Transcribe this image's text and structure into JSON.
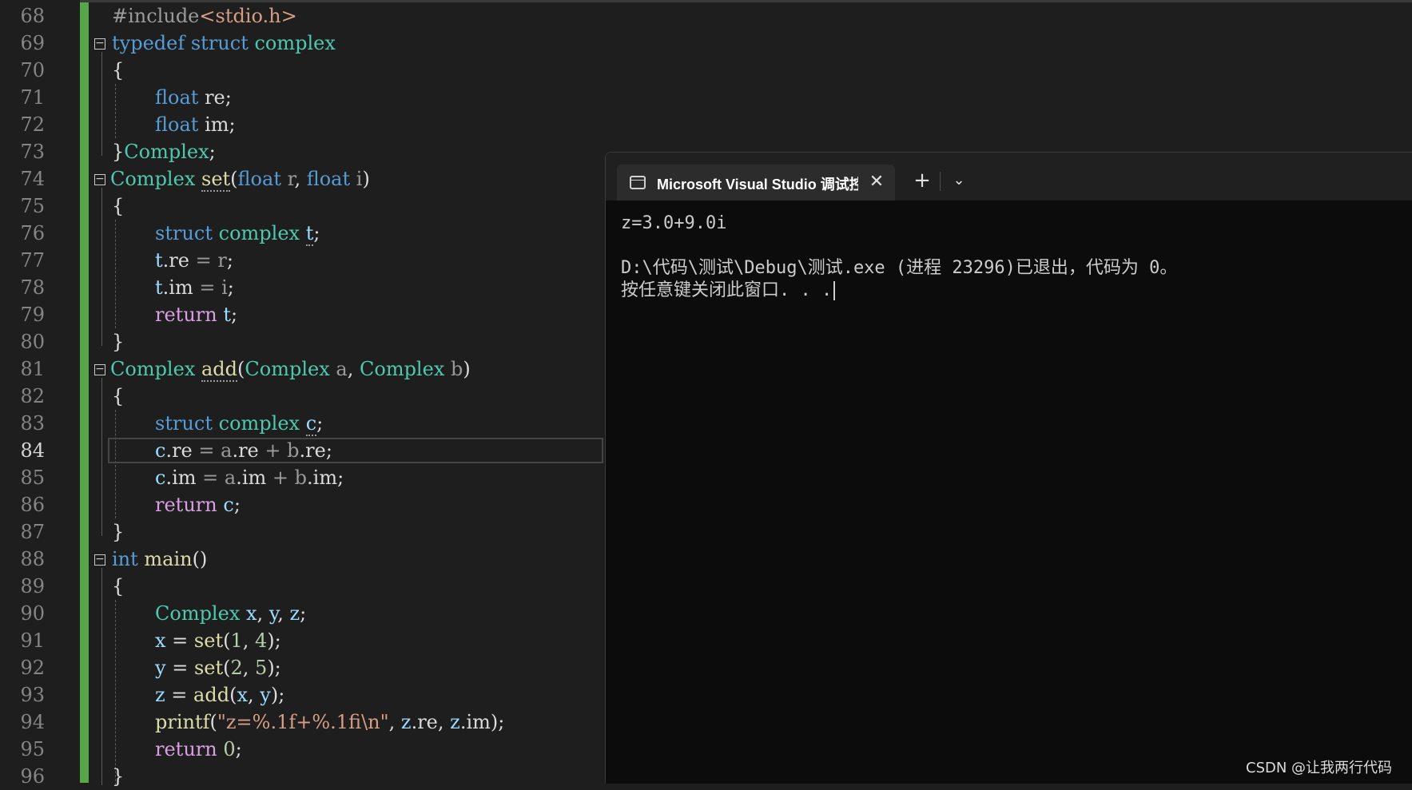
{
  "editor": {
    "line_numbers": [
      "68",
      "69",
      "70",
      "71",
      "72",
      "73",
      "74",
      "75",
      "76",
      "77",
      "78",
      "79",
      "80",
      "81",
      "82",
      "83",
      "84",
      "85",
      "86",
      "87",
      "88",
      "89",
      "90",
      "91",
      "92",
      "93",
      "94",
      "95",
      "96"
    ],
    "current_line": "84",
    "code": {
      "l68": {
        "pp": "#include",
        "inc": "<stdio.h>"
      },
      "l69": {
        "kw1": "typedef",
        "kw2": "struct",
        "ty": "complex"
      },
      "l70": "{",
      "l71": {
        "kw": "float",
        "id": "re",
        "p": ";"
      },
      "l72": {
        "kw": "float",
        "id": "im",
        "p": ";"
      },
      "l73": {
        "p": "}",
        "ty": "Complex",
        "p2": ";"
      },
      "l74": {
        "ty": "Complex",
        "fn": "set",
        "p1": "(",
        "kw1": "float",
        "pm1": "r",
        "p2": ", ",
        "kw2": "float",
        "pm2": "i",
        "p3": ")"
      },
      "l75": "{",
      "l76": {
        "kw": "struct",
        "ty": "complex",
        "id": "t",
        "p": ";"
      },
      "l77": {
        "a": "t",
        "b": ".re",
        "c": " = ",
        "d": "r",
        "e": ";"
      },
      "l78": {
        "a": "t",
        "b": ".im",
        "c": " = ",
        "d": "i",
        "e": ";"
      },
      "l79": {
        "kw": "return",
        "id": "t",
        "p": ";"
      },
      "l80": "}",
      "l81": {
        "ty": "Complex",
        "fn": "add",
        "p1": "(",
        "ty1": "Complex",
        "pm1": "a",
        "p2": ", ",
        "ty2": "Complex",
        "pm2": "b",
        "p3": ")"
      },
      "l82": "{",
      "l83": {
        "kw": "struct",
        "ty": "complex",
        "id": "c",
        "p": ";"
      },
      "l84": {
        "a": "c",
        "b": ".re",
        "c": " = ",
        "d": "a",
        "e": ".re",
        "f": " + ",
        "g": "b",
        "h": ".re",
        "i": ";"
      },
      "l85": {
        "a": "c",
        "b": ".im",
        "c": " = ",
        "d": "a",
        "e": ".im",
        "f": " + ",
        "g": "b",
        "h": ".im",
        "i": ";"
      },
      "l86": {
        "kw": "return",
        "id": "c",
        "p": ";"
      },
      "l87": "}",
      "l88": {
        "kw": "int",
        "fn": "main",
        "p": "()"
      },
      "l89": "{",
      "l90": {
        "ty": "Complex",
        "x": "x",
        "c1": ", ",
        "y": "y",
        "c2": ", ",
        "z": "z",
        "p": ";"
      },
      "l91": {
        "v": "x",
        "eq": " = ",
        "fn": "set",
        "o": "(",
        "n1": "1",
        "c": ", ",
        "n2": "4",
        "cl": ");"
      },
      "l92": {
        "v": "y",
        "eq": " = ",
        "fn": "set",
        "o": "(",
        "n1": "2",
        "c": ", ",
        "n2": "5",
        "cl": ");"
      },
      "l93": {
        "v": "z",
        "eq": " = ",
        "fn": "add",
        "o": "(",
        "a1": "x",
        "c": ", ",
        "a2": "y",
        "cl": ");"
      },
      "l94": {
        "fn": "printf",
        "o": "(",
        "str": "\"z=%.1f+%.1fi\\n\"",
        "c1": ", ",
        "z1": "z",
        "f1": ".re",
        "c2": ", ",
        "z2": "z",
        "f2": ".im",
        "cl": ");"
      },
      "l95": {
        "kw": "return",
        "n": "0",
        "p": ";"
      },
      "l96": "}"
    }
  },
  "terminal": {
    "tab_title": "Microsoft Visual Studio 调试控制台",
    "close_glyph": "✕",
    "new_tab_glyph": "+",
    "dropdown_glyph": "⌄",
    "output": [
      "z=3.0+9.0i",
      "",
      "D:\\代码\\测试\\Debug\\测试.exe (进程 23296)已退出，代码为 0。",
      "按任意键关闭此窗口. . ."
    ]
  },
  "watermark": "CSDN @让我两行代码",
  "colors": {
    "editor_bg": "#1e1e1e",
    "keyword": "#569cd6",
    "type": "#4ec9b0",
    "function": "#dcdcaa",
    "string": "#d69d85",
    "number": "#b5cea8",
    "control": "#d8a0df",
    "change_bar": "#57a64a",
    "terminal_bg": "#0c0c0c"
  }
}
